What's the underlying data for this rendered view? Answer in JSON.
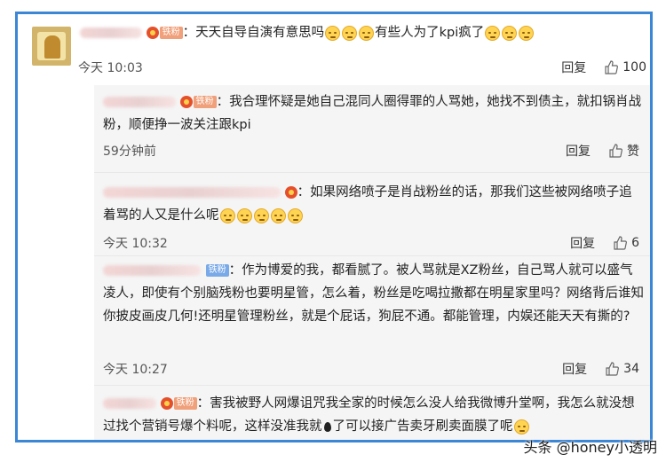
{
  "main": {
    "author_badge": "铁粉",
    "text_a": "：天天自导自演有意思吗",
    "text_b": "有些人为了kpi疯了",
    "time": "今天 10:03",
    "reply_label": "回复",
    "like_count": "100"
  },
  "replies": [
    {
      "badge": "铁粉",
      "text": "：我合理怀疑是她自己混同人圈得罪的人骂她，她找不到债主，就扣锅肖战粉，顺便挣一波关注跟kpi",
      "time": "59分钟前",
      "reply_label": "回复",
      "like_label": "赞"
    },
    {
      "badge": "",
      "text": "：如果网络喷子是肖战粉丝的话，那我们这些被网络喷子追着骂的人又是什么呢",
      "time": "今天 10:32",
      "reply_label": "回复",
      "like_label": "6"
    },
    {
      "badge": "铁粉",
      "text": "：作为博爱的我，都看腻了。被人骂就是XZ粉丝，自己骂人就可以盛气凌人，即使有个别脑残粉也要明星管，怎么着，粉丝是吃喝拉撒都在明星家里吗？网络背后谁知你披皮画皮几何!还明星管理粉丝，就是个屁话，狗屁不通。都能管理，内娱还能天天有撕的?",
      "time": "今天 10:27",
      "reply_label": "回复",
      "like_label": "34"
    },
    {
      "badge": "铁粉",
      "text": "：害我被野人网爆诅咒我全家的时候怎么没人给我微博升堂啊，我怎么就没想过找个营销号爆个料呢，这样没准我就",
      "text_tail": "了可以接广告卖牙刷卖面膜了呢"
    }
  ],
  "watermark": "头条 @honey小透明",
  "colors": {
    "frame": "#3c86d6",
    "badge": "#f0a07a",
    "sub_bg": "#f5f5f5"
  }
}
